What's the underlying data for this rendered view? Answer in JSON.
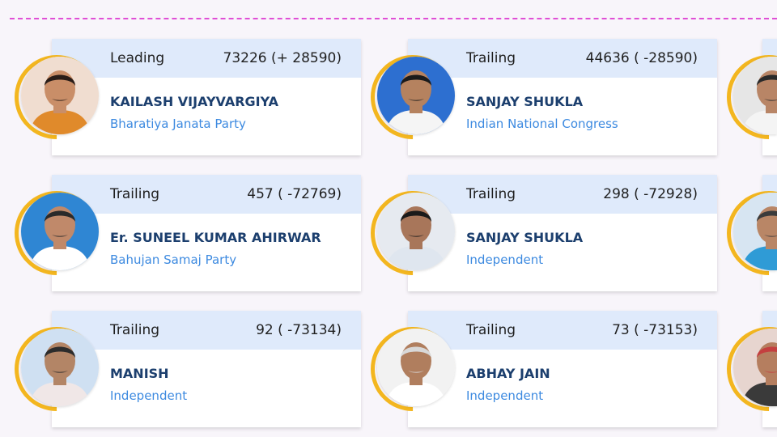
{
  "cards": [
    {
      "status": "Leading",
      "votes": "73226 (+ 28590)",
      "name": "KAILASH VIJAYVARGIYA",
      "party": "Bharatiya Janata Party",
      "avatar_icon": "candidate-photo",
      "bg": "#f0ddd0",
      "skin": "#c98e68",
      "shirt": "#e08a2b",
      "hair": "#2a1d18"
    },
    {
      "status": "Trailing",
      "votes": "44636 ( -28590)",
      "name": "SANJAY SHUKLA",
      "party": "Indian National Congress",
      "avatar_icon": "candidate-photo",
      "bg": "#2d6fd0",
      "skin": "#b5825f",
      "shirt": "#f5f5f5",
      "hair": "#1b1b1b"
    },
    {
      "status": "Trailing",
      "votes": "457 ( -72769)",
      "name": "Er. SUNEEL KUMAR AHIRWAR",
      "party": "Bahujan Samaj Party",
      "avatar_icon": "candidate-photo",
      "bg": "#2f86d3",
      "skin": "#c0896a",
      "shirt": "#ffffff",
      "hair": "#2a2a2a"
    },
    {
      "status": "Trailing",
      "votes": "298 ( -72928)",
      "name": "SANJAY SHUKLA",
      "party": "Independent",
      "avatar_icon": "candidate-photo",
      "bg": "#e6eaf0",
      "skin": "#a8765a",
      "shirt": "#dfe6ef",
      "hair": "#1a1a1a"
    },
    {
      "status": "Trailing",
      "votes": "92 ( -73134)",
      "name": "MANISH",
      "party": "Independent",
      "avatar_icon": "candidate-photo",
      "bg": "#cfe0f2",
      "skin": "#b38566",
      "shirt": "#f0e7e7",
      "hair": "#2c2c2c"
    },
    {
      "status": "Trailing",
      "votes": "73 ( -73153)",
      "name": "ABHAY JAIN",
      "party": "Independent",
      "avatar_icon": "candidate-photo",
      "bg": "#f2f2f2",
      "skin": "#b07e5e",
      "shirt": "#ffffff",
      "hair": "#d8d8d8"
    }
  ],
  "edge_avatars": [
    {
      "avatar_icon": "candidate-photo",
      "bg": "#e6e6e6",
      "skin": "#b88566",
      "shirt": "#f4f4f4",
      "hair": "#2a2a2a"
    },
    {
      "avatar_icon": "candidate-photo",
      "bg": "#d7e5f2",
      "skin": "#b98666",
      "shirt": "#2f9bd6",
      "hair": "#3b3b3b"
    },
    {
      "avatar_icon": "candidate-photo",
      "bg": "#e7d5cf",
      "skin": "#b57e5f",
      "shirt": "#3a3a3a",
      "hair": "#c43f3f"
    }
  ],
  "colors": {
    "accent_ring": "#f3b61f",
    "header_bg": "#dfeafb",
    "name_color": "#1c3f6e",
    "party_color": "#3d8ae0",
    "divider": "#e04fd6"
  }
}
